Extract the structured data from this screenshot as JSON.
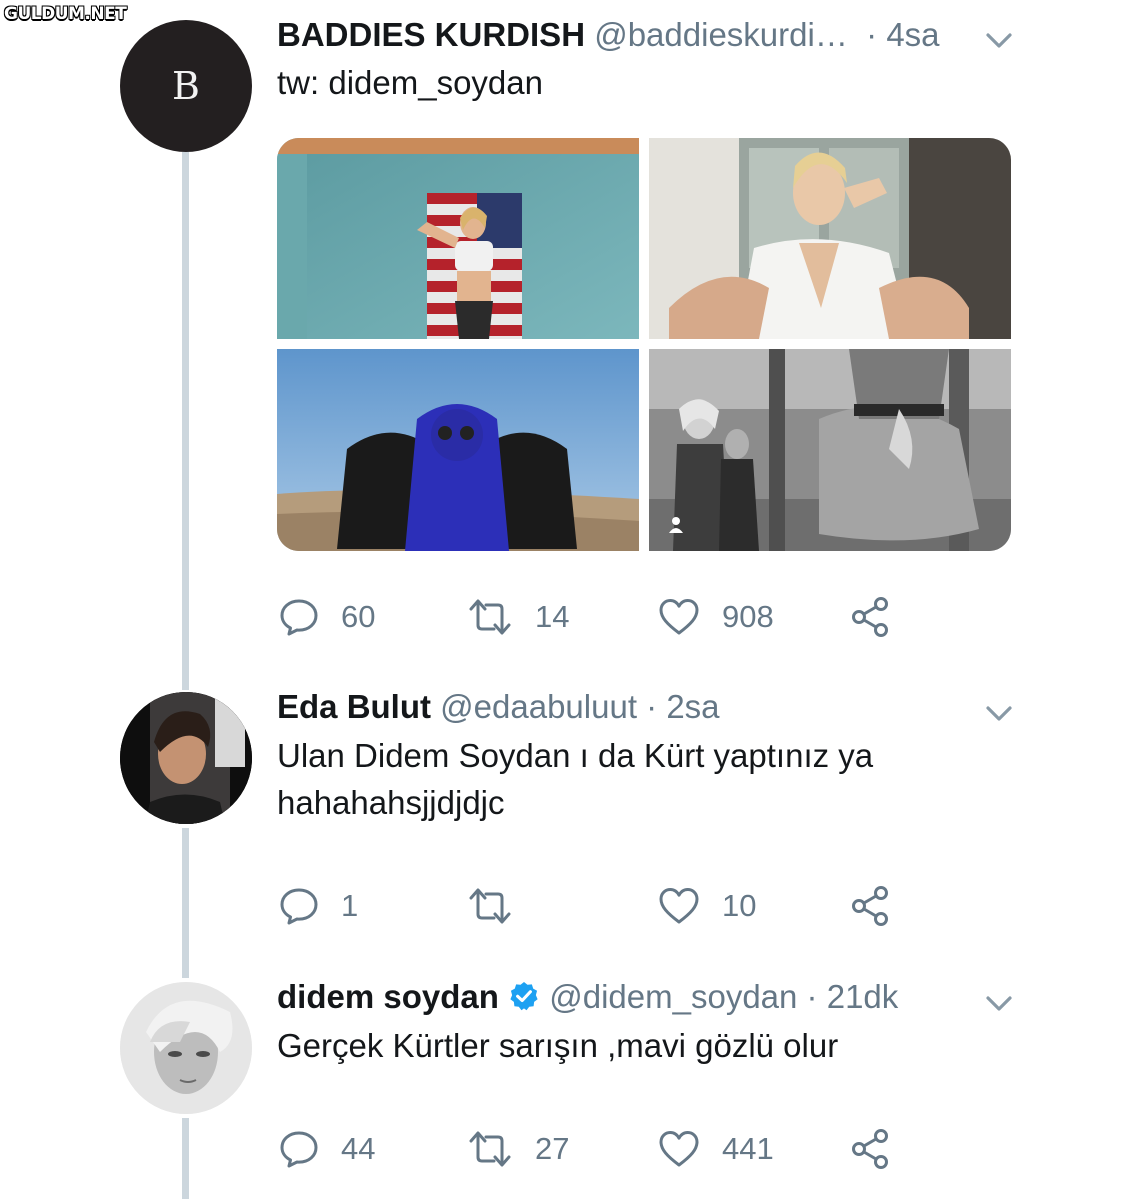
{
  "watermark": "GULDUM.NET",
  "colors": {
    "text": "#14171a",
    "secondary": "#657786",
    "thread_line": "#ccd6dd",
    "verified": "#1da1f2"
  },
  "tweets": [
    {
      "avatar_letter": "B",
      "name": "BADDIES KURDISH",
      "handle": "@baddieskurdi…",
      "time": "4sa",
      "text_lines": [
        "tw: didem_soydan"
      ],
      "media": [
        "flag-photo",
        "window-photo",
        "blue-scarf-photo",
        "street-bw-photo"
      ],
      "counts": {
        "reply": "60",
        "retweet": "14",
        "like": "908"
      }
    },
    {
      "name": "Eda Bulut",
      "handle": "@edaabuluut",
      "time": "2sa",
      "text_lines": [
        "Ulan Didem Soydan ı da Kürt yaptınız ya",
        "hahahahsjjdjdjc"
      ],
      "counts": {
        "reply": "1",
        "retweet": "",
        "like": "10"
      }
    },
    {
      "name": "didem soydan",
      "verified": true,
      "handle": "@didem_soydan",
      "time": "21dk",
      "text_lines": [
        "Gerçek Kürtler sarışın ,mavi gözlü olur"
      ],
      "counts": {
        "reply": "44",
        "retweet": "27",
        "like": "441"
      }
    }
  ]
}
